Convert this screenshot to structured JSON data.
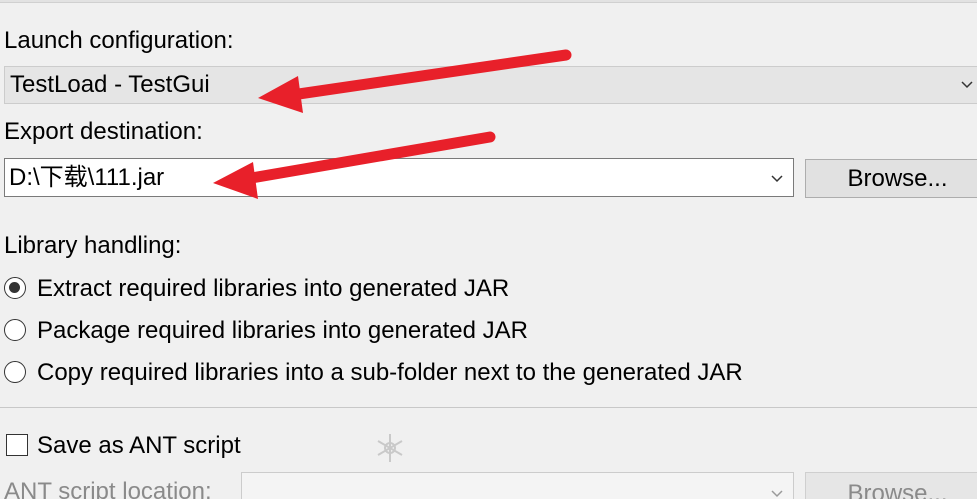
{
  "launch": {
    "label": "Launch configuration:",
    "value": "TestLoad - TestGui",
    "dropdown_icon": "chevron-down-icon"
  },
  "export": {
    "label": "Export destination:",
    "value": "D:\\下载\\111.jar",
    "dropdown_icon": "chevron-down-icon",
    "browse_label": "Browse..."
  },
  "library": {
    "label": "Library handling:",
    "options": [
      {
        "label": "Extract required libraries into generated JAR",
        "selected": true
      },
      {
        "label": "Package required libraries into generated JAR",
        "selected": false
      },
      {
        "label": "Copy required libraries into a sub-folder next to the generated JAR",
        "selected": false
      }
    ]
  },
  "ant": {
    "checkbox_label": "Save as ANT script",
    "checked": false,
    "location_label": "ANT script location:",
    "browse_label": "Browse..."
  },
  "annotations": {
    "arrow_color": "#e8202a",
    "arrow_icon": "red-arrow-icon"
  },
  "colors": {
    "background": "#f0f0f0",
    "readonly_combo": "#e5e5e5",
    "button": "#e1e1e1"
  }
}
